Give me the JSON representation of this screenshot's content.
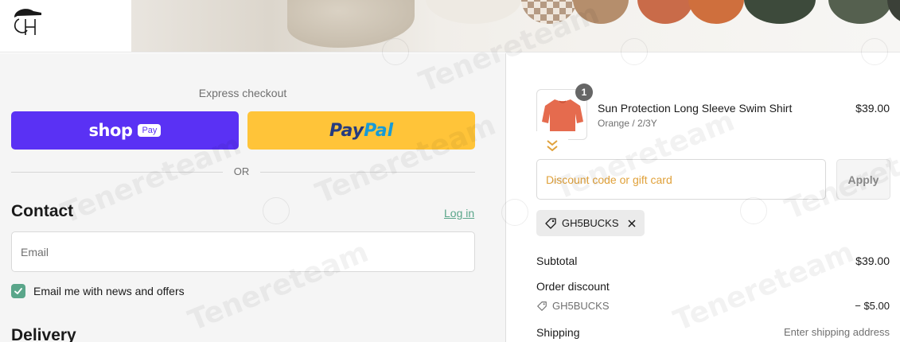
{
  "header": {
    "logo_text": "GH"
  },
  "express": {
    "label": "Express checkout",
    "shop_word": "shop",
    "shop_pay_badge": "Pay",
    "paypal_part1": "Pay",
    "paypal_part2": "Pal",
    "divider": "OR"
  },
  "contact": {
    "title": "Contact",
    "login_link": "Log in",
    "email_placeholder": "Email",
    "newsletter_label": "Email me with news and offers",
    "newsletter_checked": true
  },
  "delivery": {
    "title": "Delivery"
  },
  "cart": {
    "item": {
      "quantity": "1",
      "name": "Sun Protection Long Sleeve Swim Shirt",
      "variant": "Orange / 2/3Y",
      "price": "$39.00"
    },
    "discount_placeholder": "Discount code or gift card",
    "apply_label": "Apply",
    "applied_code": "GH5BUCKS"
  },
  "summary": {
    "subtotal_label": "Subtotal",
    "subtotal_value": "$39.00",
    "order_discount_label": "Order discount",
    "discount_code": "GH5BUCKS",
    "discount_value": "− $5.00",
    "shipping_label": "Shipping",
    "shipping_value": "Enter shipping address"
  },
  "colors": {
    "shop_pay": "#5a31f4",
    "paypal": "#ffc439",
    "accent": "#5aa68a",
    "placeholder_accent": "#e0a13a"
  }
}
